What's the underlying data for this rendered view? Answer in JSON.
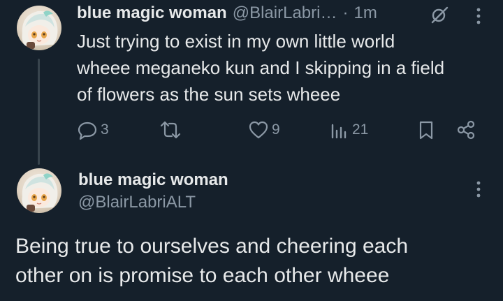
{
  "tweet1": {
    "display_name": "blue magic woman",
    "handle": "@BlairLabri…",
    "separator": "·",
    "time": "1m",
    "text_lines": [
      "Just trying to exist in my own little world",
      "wheee meganeko kun and I skipping in a field",
      "of flowers as the sun sets wheee"
    ],
    "actions": {
      "replies": "3",
      "likes": "9",
      "views": "21"
    }
  },
  "tweet2": {
    "display_name": "blue magic woman",
    "handle": "@BlairLabriALT",
    "text_lines": [
      "Being true to ourselves and cheering each",
      "other on is promise to each other wheee"
    ]
  },
  "icons": {
    "reply": "reply-icon",
    "retweet": "retweet-icon",
    "like": "heart-icon",
    "views": "analytics-icon",
    "bookmark": "bookmark-icon",
    "share": "share-icon",
    "more": "more-vertical-icon",
    "grok": "grok-icon"
  },
  "colors": {
    "background": "#15202b",
    "text": "#e7e9ea",
    "muted": "#8b98a5",
    "thread_line": "#38444d"
  }
}
